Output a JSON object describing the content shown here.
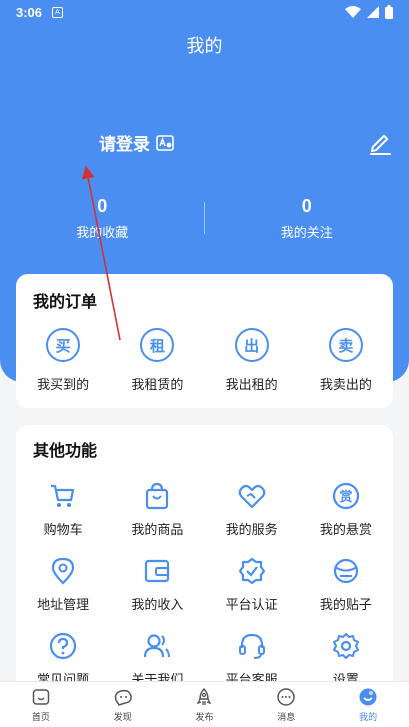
{
  "status_bar": {
    "time": "3:06",
    "notif_glyph": "A"
  },
  "header": {
    "title": "我的"
  },
  "profile": {
    "login_label": "请登录"
  },
  "stats": [
    {
      "value": "0",
      "label": "我的收藏"
    },
    {
      "value": "0",
      "label": "我的关注"
    }
  ],
  "orders": {
    "title": "我的订单",
    "items": [
      {
        "badge": "买",
        "label": "我买到的"
      },
      {
        "badge": "租",
        "label": "我租赁的"
      },
      {
        "badge": "出",
        "label": "我出租的"
      },
      {
        "badge": "卖",
        "label": "我卖出的"
      }
    ]
  },
  "tools": {
    "title": "其他功能",
    "items": [
      {
        "label": "购物车",
        "icon": "cart-icon"
      },
      {
        "label": "我的商品",
        "icon": "bag-icon"
      },
      {
        "label": "我的服务",
        "icon": "service-icon"
      },
      {
        "label": "我的悬赏",
        "icon": "reward-icon",
        "glyph": "赏"
      },
      {
        "label": "地址管理",
        "icon": "location-icon"
      },
      {
        "label": "我的收入",
        "icon": "wallet-icon"
      },
      {
        "label": "平台认证",
        "icon": "verified-icon"
      },
      {
        "label": "我的贴子",
        "icon": "post-icon"
      },
      {
        "label": "常见问题",
        "icon": "help-icon"
      },
      {
        "label": "关于我们",
        "icon": "about-icon"
      },
      {
        "label": "平台客服",
        "icon": "headset-icon"
      },
      {
        "label": "设置",
        "icon": "settings-icon"
      }
    ]
  },
  "tabbar": {
    "items": [
      {
        "label": "首页",
        "icon": "home-icon"
      },
      {
        "label": "发现",
        "icon": "discover-icon"
      },
      {
        "label": "发布",
        "icon": "rocket-icon"
      },
      {
        "label": "消息",
        "icon": "message-icon"
      },
      {
        "label": "我的",
        "icon": "profile-icon",
        "active": true
      }
    ]
  },
  "colors": {
    "accent": "#4a8ef2",
    "annotation": "#d83030"
  }
}
